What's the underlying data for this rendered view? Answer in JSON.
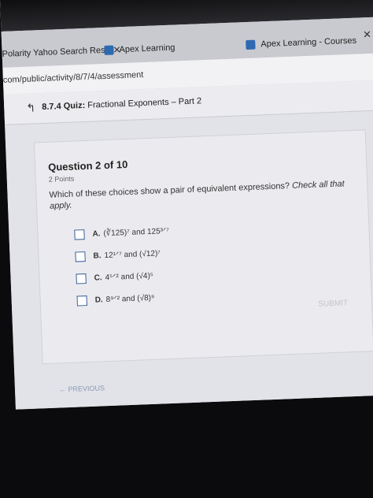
{
  "browser": {
    "tabs": [
      {
        "label": "Polarity Yahoo Search Res",
        "close": "✕"
      },
      {
        "label": "Apex Learning",
        "close": "✕"
      },
      {
        "label": "Apex Learning - Courses",
        "close": "✕"
      }
    ],
    "url": "com/public/activity/8/7/4/assessment"
  },
  "quiz": {
    "header": "8.7.4  Quiz:",
    "header_title": "Fractional Exponents – Part 2",
    "question_number": "Question 2 of 10",
    "points": "2 Points",
    "prompt": "Which of these choices show a pair of equivalent expressions?",
    "prompt_italic": "Check all that apply.",
    "choices": [
      {
        "letter": "A.",
        "text": "(∛125)⁷ and 125³ᐟ⁷"
      },
      {
        "letter": "B.",
        "text": "12¹ᐟ⁷ and (√12)⁷"
      },
      {
        "letter": "C.",
        "text": "4⁵ᐟ² and (√4)⁵"
      },
      {
        "letter": "D.",
        "text": "8⁹ᐟ² and (√8)⁹"
      }
    ],
    "submit": "SUBMIT",
    "previous": "← PREVIOUS"
  },
  "taskbar": {
    "icons": [
      "window-icon",
      "edge-icon",
      "store-icon",
      "dropbox-icon",
      "ie-icon",
      "app-icon",
      "media-icon",
      "settings-icon",
      "chrome-icon"
    ]
  }
}
